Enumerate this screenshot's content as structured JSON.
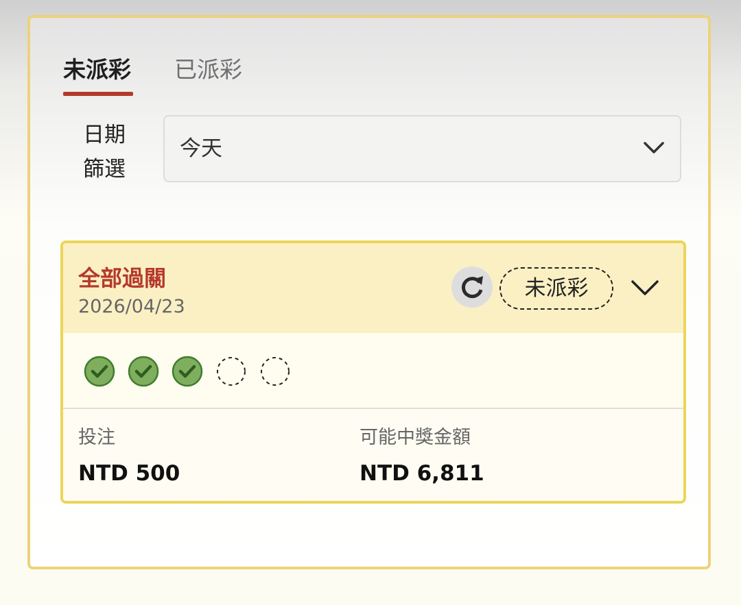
{
  "tabs": [
    {
      "label": "未派彩",
      "active": true
    },
    {
      "label": "已派彩",
      "active": false
    }
  ],
  "filter": {
    "label_line1": "日期",
    "label_line2": "篩選",
    "selected": "今天",
    "icon": "chevron-down-icon"
  },
  "bet_card": {
    "title": "全部過關",
    "date": "2026/04/23",
    "status": "未派彩",
    "refresh_icon": "refresh-icon",
    "expand_icon": "chevron-down-icon",
    "legs": [
      {
        "state": "won",
        "icon": "check-circle-icon"
      },
      {
        "state": "won",
        "icon": "check-circle-icon"
      },
      {
        "state": "won",
        "icon": "check-circle-icon"
      },
      {
        "state": "pending",
        "icon": "dashed-circle-icon"
      },
      {
        "state": "pending",
        "icon": "dashed-circle-icon"
      }
    ],
    "stake_label": "投注",
    "stake_value": "NTD 500",
    "payout_label": "可能中獎金額",
    "payout_value": "NTD 6,811"
  },
  "colors": {
    "accent": "#b5392b",
    "card_border": "#ecd559",
    "card_header_bg": "#fbf0c4",
    "success": "#3f7d2c"
  }
}
